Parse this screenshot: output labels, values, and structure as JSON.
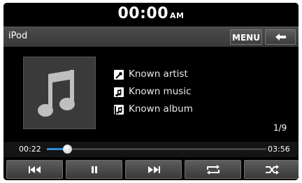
{
  "status": {
    "time": "00:00",
    "ampm": "AM"
  },
  "header": {
    "title": "iPod",
    "menu_label": "MENU"
  },
  "now_playing": {
    "artist": "Known artist",
    "music": "Known music",
    "album": "Known album",
    "track_position": "1/9"
  },
  "progress": {
    "current": "00:22",
    "total": "03:56",
    "fraction": 0.093
  },
  "controls": [
    "previous-icon",
    "pause-icon",
    "next-icon",
    "repeat-icon",
    "shuffle-icon"
  ],
  "colors": {
    "accent": "#2c8ed6",
    "background": "#000000",
    "button": "#4a4a4a"
  }
}
